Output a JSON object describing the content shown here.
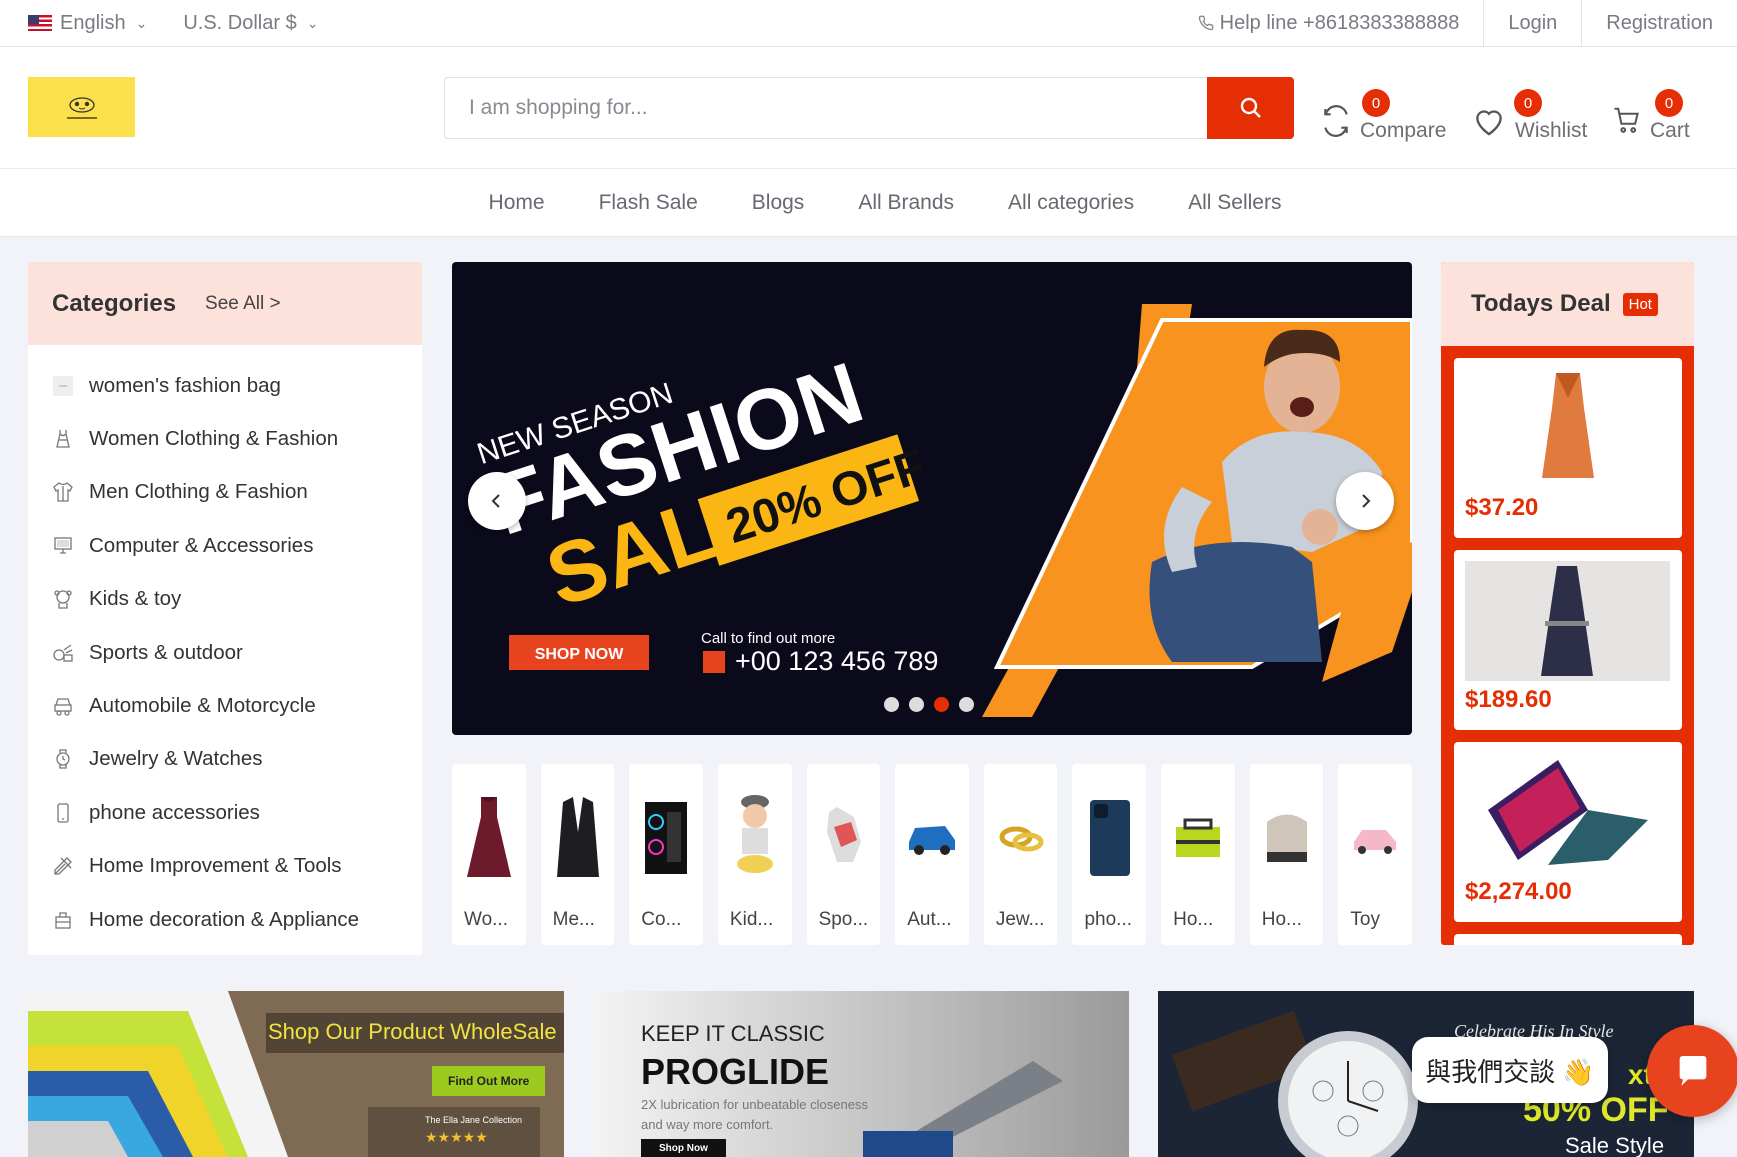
{
  "topbar": {
    "language": "English",
    "currency": "U.S. Dollar $",
    "help": "Help line +8618383388888",
    "login": "Login",
    "registration": "Registration"
  },
  "header": {
    "search_placeholder": "I am shopping for...",
    "compare": {
      "label": "Compare",
      "count": "0"
    },
    "wishlist": {
      "label": "Wishlist",
      "count": "0"
    },
    "cart": {
      "label": "Cart",
      "count": "0"
    }
  },
  "nav": [
    "Home",
    "Flash Sale",
    "Blogs",
    "All Brands",
    "All categories",
    "All Sellers"
  ],
  "categories": {
    "title": "Categories",
    "see_all": "See All >",
    "items": [
      {
        "label": "women's fashion bag",
        "icon": "bag-placeholder-icon"
      },
      {
        "label": "Women Clothing & Fashion",
        "icon": "dress-icon"
      },
      {
        "label": "Men Clothing & Fashion",
        "icon": "shirt-icon"
      },
      {
        "label": "Computer & Accessories",
        "icon": "computer-icon"
      },
      {
        "label": "Kids & toy",
        "icon": "toy-icon"
      },
      {
        "label": "Sports & outdoor",
        "icon": "sports-icon"
      },
      {
        "label": "Automobile & Motorcycle",
        "icon": "car-icon"
      },
      {
        "label": "Jewelry & Watches",
        "icon": "watch-icon"
      },
      {
        "label": "phone accessories",
        "icon": "phone-icon"
      },
      {
        "label": "Home Improvement & Tools",
        "icon": "tools-icon"
      },
      {
        "label": "Home decoration & Appliance",
        "icon": "appliance-icon"
      }
    ]
  },
  "banner": {
    "kicker": "NEW SEASON",
    "headline": "FASHION",
    "sale": "SALE",
    "discount": "20% OFF",
    "cta": "SHOP NOW",
    "call_label": "Call to find out more",
    "phone": "+00 123 456 789",
    "active_slide": 3,
    "slides": 4
  },
  "tiles": [
    "Wo...",
    "Me...",
    "Co...",
    "Kid...",
    "Spo...",
    "Aut...",
    "Jew...",
    "pho...",
    "Ho...",
    "Ho...",
    "Toy"
  ],
  "deal": {
    "title": "Todays Deal",
    "badge": "Hot",
    "items": [
      {
        "price": "$37.20"
      },
      {
        "price": "$189.60"
      },
      {
        "price": "$2,274.00"
      }
    ]
  },
  "promos": {
    "p1": {
      "title": "Shop Our Product WholeSale",
      "button": "Find Out More",
      "brand": "The Ella Jane Collection"
    },
    "p2": {
      "kicker": "KEEP IT CLASSIC",
      "title": "PROGLIDE",
      "desc1": "2X lubrication for unbeatable closeness",
      "desc2": "and way more comfort.",
      "button": "Shop Now"
    },
    "p3": {
      "script": "Celebrate His In Style",
      "partial": "xtra",
      "off": "50% OFF",
      "style": "Sale Style"
    }
  },
  "chat": {
    "label": "與我們交談 👋"
  },
  "colors": {
    "accent": "#e62e04",
    "banner_bg": "#0b0a1b",
    "orange": "#f7931e",
    "yellow": "#fcb614"
  }
}
